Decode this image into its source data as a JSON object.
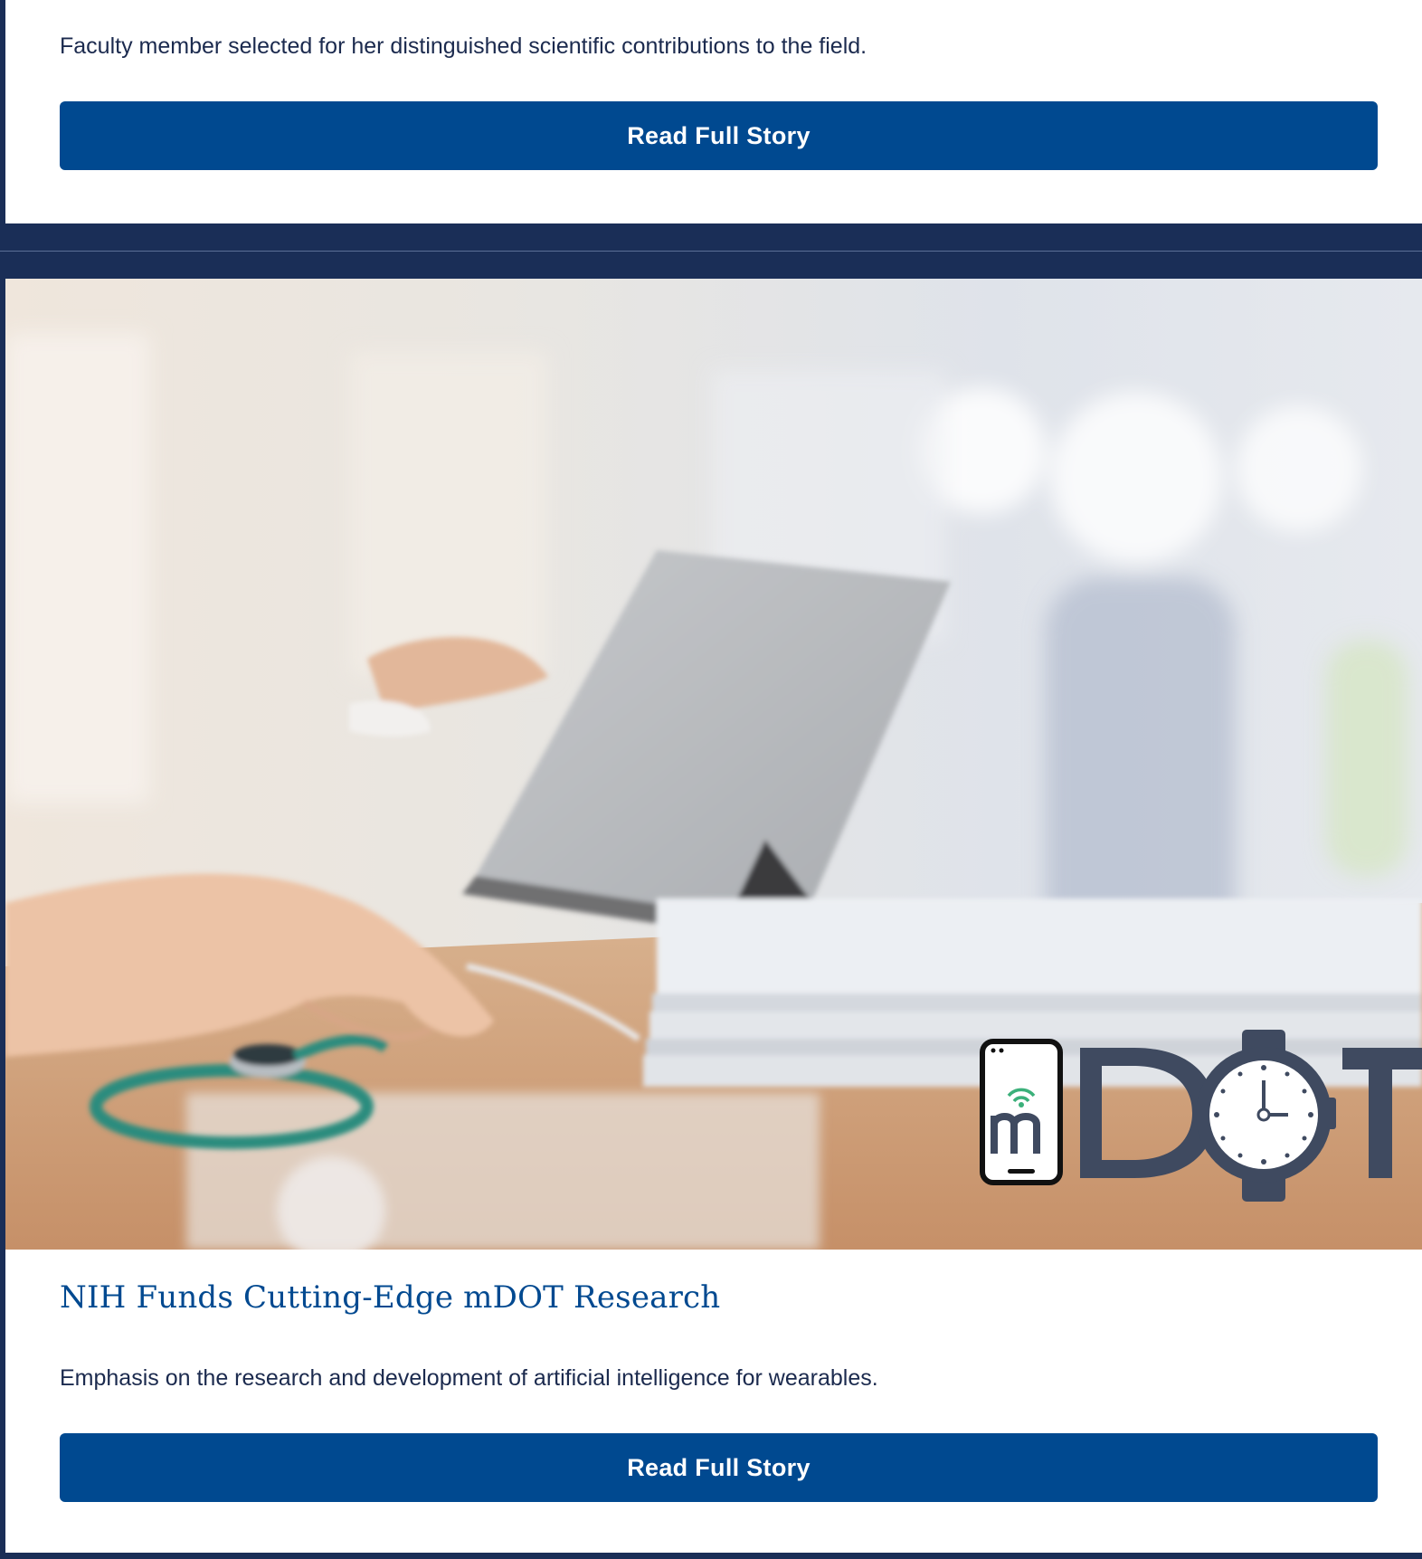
{
  "stories": [
    {
      "description": "Faculty member selected for her distinguished scientific contributions to the field.",
      "button_label": "Read Full Story"
    },
    {
      "headline": "NIH Funds Cutting-Edge mDOT Research",
      "description": "Emphasis on the research and development of artificial intelligence for wearables.",
      "button_label": "Read Full Story",
      "image_logo_text": "mDOT"
    }
  ],
  "colors": {
    "page_background": "#1a2e57",
    "button": "#004990",
    "headline": "#004990",
    "body_text": "#1b2a4e",
    "logo": "#3f4a60"
  }
}
